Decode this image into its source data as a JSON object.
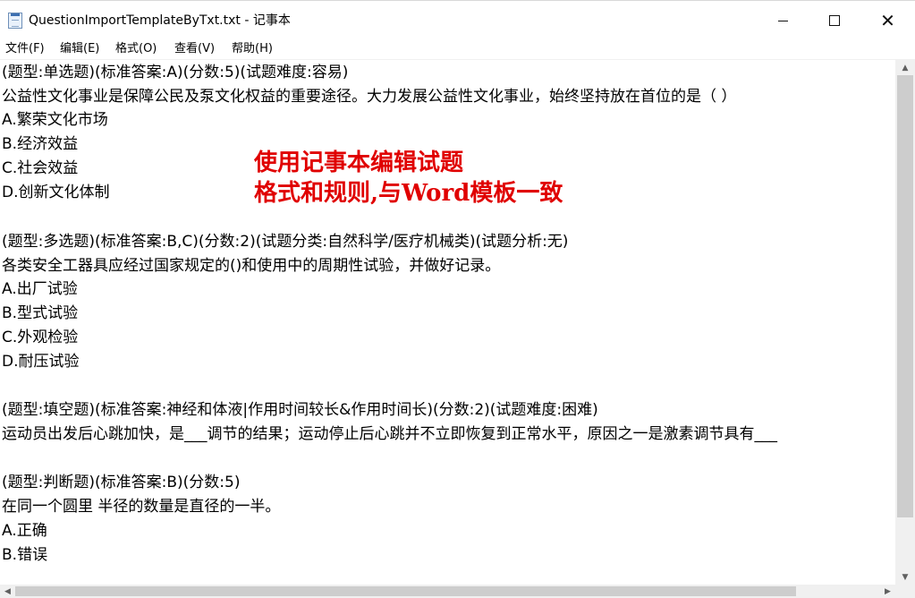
{
  "window": {
    "title": "QuestionImportTemplateByTxt.txt - 记事本",
    "minimize_glyph": "",
    "maximize_glyph": "",
    "close_glyph": "✕"
  },
  "menu": {
    "file": "文件(F)",
    "edit": "编辑(E)",
    "format": "格式(O)",
    "view": "查看(V)",
    "help": "帮助(H)"
  },
  "content": {
    "lines": [
      "(题型:单选题)(标准答案:A)(分数:5)(试题难度:容易)",
      "公益性文化事业是保障公民及泵文化权益的重要途径。大力发展公益性文化事业，始终坚持放在首位的是（ ）",
      "A.繁荣文化市场",
      "B.经济效益",
      "C.社会效益",
      "D.创新文化体制",
      "",
      "(题型:多选题)(标准答案:B,C)(分数:2)(试题分类:自然科学/医疗机械类)(试题分析:无)",
      "各类安全工器具应经过国家规定的()和使用中的周期性试验，并做好记录。",
      "A.出厂试验",
      "B.型式试验",
      "C.外观检验",
      "D.耐压试验",
      "",
      "(题型:填空题)(标准答案:神经和体液|作用时间较长&作用时间长)(分数:2)(试题难度:困难)",
      "运动员出发后心跳加快，是___调节的结果；运动停止后心跳并不立即恢复到正常水平，原因之一是激素调节具有___",
      "",
      "(题型:判断题)(标准答案:B)(分数:5)",
      "在同一个圆里 半径的数量是直径的一半。",
      "A.正确",
      "B.错误"
    ]
  },
  "annotation": {
    "line1": "使用记事本编辑试题",
    "line2": "格式和规则,与Word模板一致",
    "color": "#e00000"
  },
  "scrollbars": {
    "up_arrow": "▲",
    "down_arrow": "▼",
    "left_arrow": "◀",
    "right_arrow": "▶"
  }
}
